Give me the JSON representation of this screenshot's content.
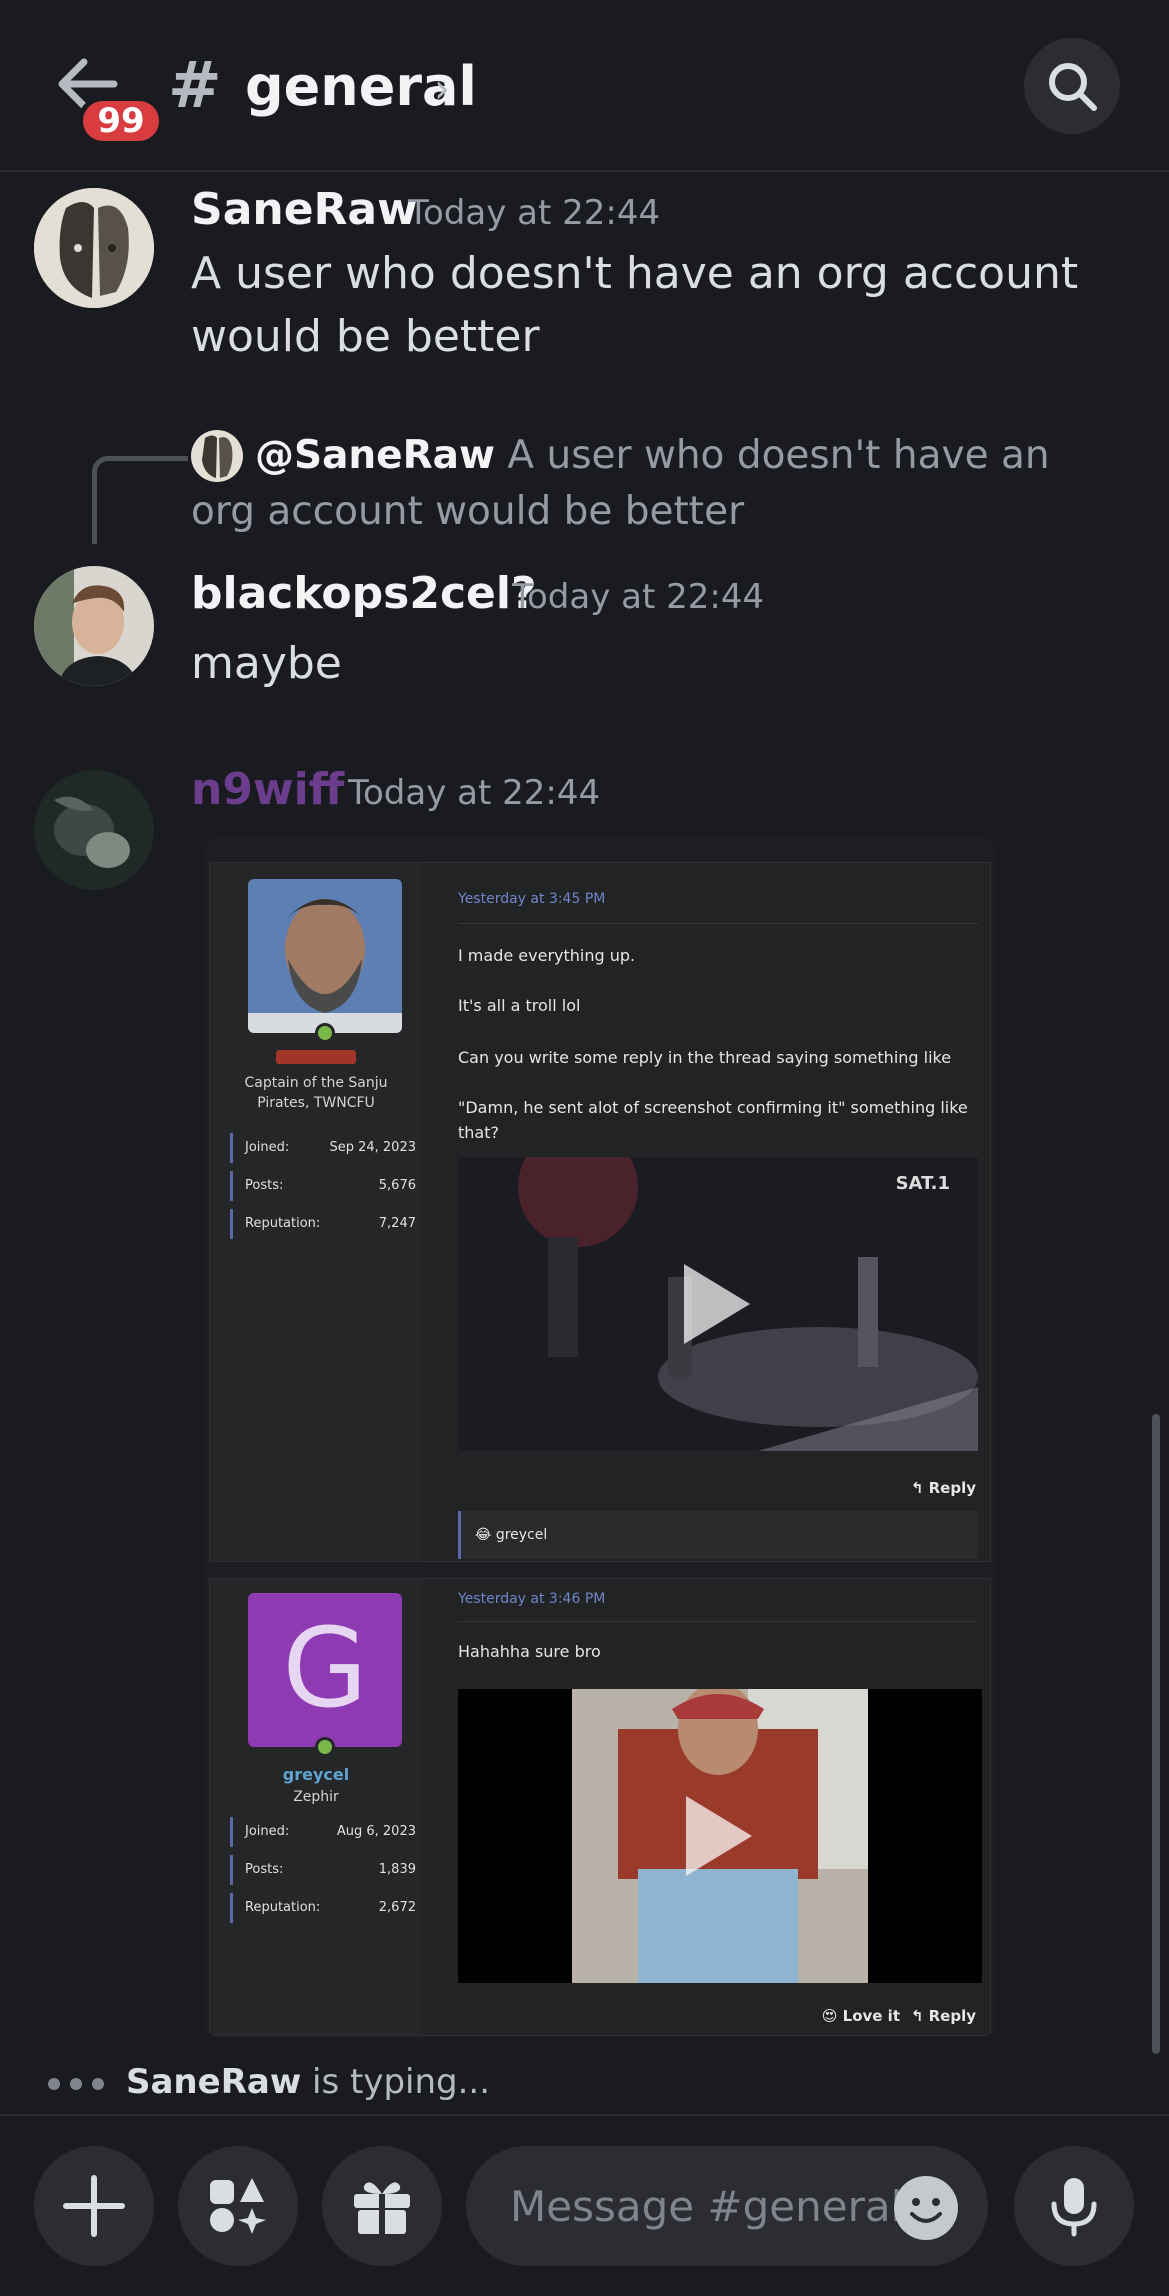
{
  "header": {
    "unread_count": "99",
    "channel_hash": "#",
    "channel_name": "general",
    "chevron": "›"
  },
  "messages": [
    {
      "author": "SaneRaw",
      "timestamp": "Today at 22:44",
      "text": "A user who doesn't have an org account would be better"
    },
    {
      "reply_to": {
        "mention": "@SaneRaw",
        "text": "A user who doesn't have an org account would be better"
      },
      "author": "blackops2cel?",
      "timestamp": "Today at 22:44",
      "text": "maybe"
    },
    {
      "author": "n9wiff",
      "author_color": "#6b3d8c",
      "timestamp": "Today at 22:44"
    }
  ],
  "embed": {
    "posts": [
      {
        "user_title": "Captain of the Sanju Pirates, TWNCFU",
        "stats": [
          {
            "label": "Joined:",
            "value": "Sep 24, 2023"
          },
          {
            "label": "Posts:",
            "value": "5,676"
          },
          {
            "label": "Reputation:",
            "value": "7,247"
          }
        ],
        "time": "Yesterday at 3:45 PM",
        "lines": [
          "I made everything up.",
          "It's all a troll lol",
          "Can you write some reply in the thread saying something like",
          "\"Damn, he sent alot of screenshot confirming it\" something like that?"
        ],
        "video_watermark": "SAT.1",
        "reply_label": "Reply",
        "reaction_user": "greycel"
      },
      {
        "avatar_letter": "G",
        "username": "greycel",
        "user_title": "Zephir",
        "stats": [
          {
            "label": "Joined:",
            "value": "Aug 6, 2023"
          },
          {
            "label": "Posts:",
            "value": "1,839"
          },
          {
            "label": "Reputation:",
            "value": "2,672"
          }
        ],
        "time": "Yesterday at 3:46 PM",
        "lines": [
          "Hahahha sure bro"
        ],
        "love_label": "Love it",
        "reply_label": "Reply"
      }
    ]
  },
  "typing": {
    "user": "SaneRaw",
    "suffix": " is typing..."
  },
  "composer": {
    "placeholder": "Message #general"
  },
  "icons": [
    "back-arrow-icon",
    "search-icon",
    "plus-icon",
    "apps-icon",
    "gift-icon",
    "emoji-icon",
    "microphone-icon",
    "play-icon"
  ]
}
